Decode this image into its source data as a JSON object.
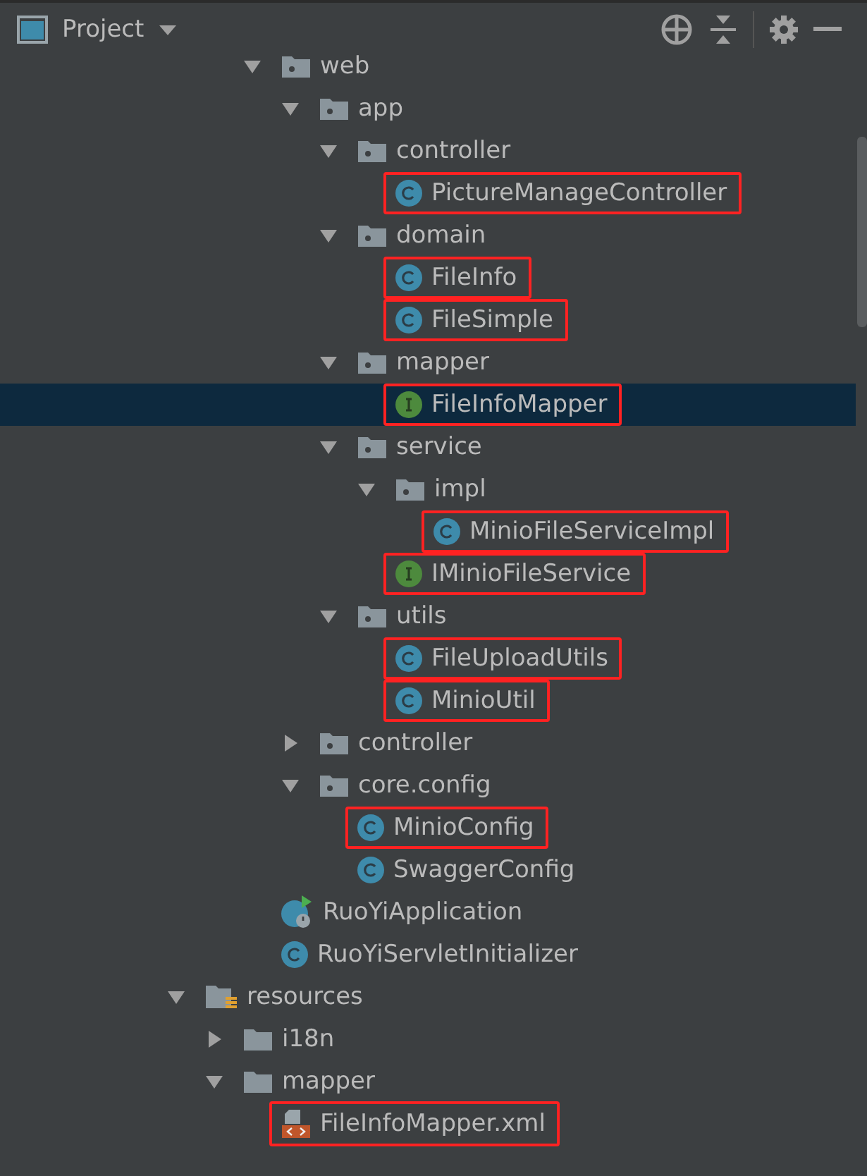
{
  "header": {
    "title": "Project"
  },
  "tree": [
    {
      "children": [
        {
          "children": [
            {
              "label": "web",
              "kind": "package",
              "expanded": true,
              "selected": false,
              "boxed": false,
              "children": [
                {
                  "label": "app",
                  "kind": "package",
                  "expanded": true,
                  "selected": false,
                  "boxed": false,
                  "children": [
                    {
                      "label": "controller",
                      "kind": "package",
                      "expanded": true,
                      "selected": false,
                      "boxed": false,
                      "children": [
                        {
                          "label": "PictureManageController",
                          "kind": "class",
                          "selected": false,
                          "boxed": true
                        }
                      ]
                    },
                    {
                      "label": "domain",
                      "kind": "package",
                      "expanded": true,
                      "selected": false,
                      "boxed": false,
                      "children": [
                        {
                          "label": "FileInfo",
                          "kind": "class",
                          "selected": false,
                          "boxed": true
                        },
                        {
                          "label": "FileSimple",
                          "kind": "class",
                          "selected": false,
                          "boxed": true
                        }
                      ]
                    },
                    {
                      "label": "mapper",
                      "kind": "package",
                      "expanded": true,
                      "selected": false,
                      "boxed": false,
                      "children": [
                        {
                          "label": "FileInfoMapper",
                          "kind": "interface",
                          "selected": true,
                          "boxed": true
                        }
                      ]
                    },
                    {
                      "label": "service",
                      "kind": "package",
                      "expanded": true,
                      "selected": false,
                      "boxed": false,
                      "children": [
                        {
                          "label": "impl",
                          "kind": "package",
                          "expanded": true,
                          "selected": false,
                          "boxed": false,
                          "children": [
                            {
                              "label": "MinioFileServiceImpl",
                              "kind": "class",
                              "selected": false,
                              "boxed": true
                            }
                          ]
                        },
                        {
                          "label": "IMinioFileService",
                          "kind": "interface",
                          "selected": false,
                          "boxed": true
                        }
                      ]
                    },
                    {
                      "label": "utils",
                      "kind": "package",
                      "expanded": true,
                      "selected": false,
                      "boxed": false,
                      "children": [
                        {
                          "label": "FileUploadUtils",
                          "kind": "class",
                          "selected": false,
                          "boxed": true
                        },
                        {
                          "label": "MinioUtil",
                          "kind": "class",
                          "selected": false,
                          "boxed": true
                        }
                      ]
                    }
                  ]
                },
                {
                  "label": "controller",
                  "kind": "package",
                  "expanded": false,
                  "selected": false,
                  "boxed": false
                },
                {
                  "label": "core.config",
                  "kind": "package",
                  "expanded": true,
                  "selected": false,
                  "boxed": false,
                  "children": [
                    {
                      "label": "MinioConfig",
                      "kind": "class",
                      "selected": false,
                      "boxed": true
                    },
                    {
                      "label": "SwaggerConfig",
                      "kind": "class",
                      "selected": false,
                      "boxed": false
                    }
                  ]
                }
              ]
            },
            {
              "label": "RuoYiApplication",
              "kind": "app-class",
              "selected": false,
              "boxed": false
            },
            {
              "label": "RuoYiServletInitializer",
              "kind": "class",
              "selected": false,
              "boxed": false
            }
          ]
        }
      ]
    },
    {
      "label": "resources",
      "kind": "resources",
      "expanded": true,
      "selected": false,
      "boxed": false,
      "children": [
        {
          "label": "i18n",
          "kind": "folder",
          "expanded": false,
          "selected": false,
          "boxed": false
        },
        {
          "label": "mapper",
          "kind": "folder",
          "expanded": true,
          "selected": false,
          "boxed": false,
          "children": [
            {
              "label": "FileInfoMapper.xml",
              "kind": "xml",
              "selected": false,
              "boxed": true
            }
          ]
        }
      ]
    }
  ]
}
